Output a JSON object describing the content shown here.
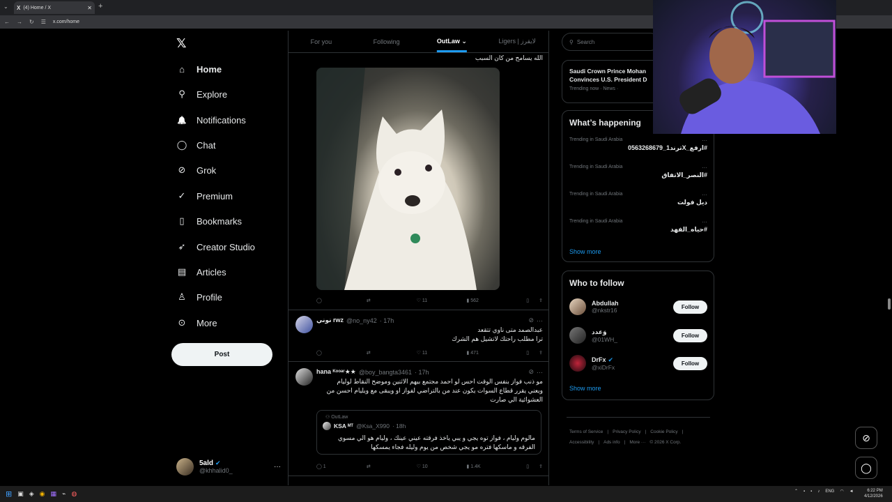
{
  "browser": {
    "tab_title": "(4) Home / X",
    "tab_close": "✕",
    "new_tab": "+",
    "url": "x.com/home"
  },
  "logo": "𝕏",
  "nav": {
    "items": [
      {
        "label": "Home",
        "icon": "home-icon",
        "glyph": "⌂"
      },
      {
        "label": "Explore",
        "icon": "search-icon",
        "glyph": "⚲"
      },
      {
        "label": "Notifications",
        "icon": "bell-icon",
        "glyph": "🔔"
      },
      {
        "label": "Chat",
        "icon": "chat-icon",
        "glyph": "◯"
      },
      {
        "label": "Grok",
        "icon": "grok-icon",
        "glyph": "⊘"
      },
      {
        "label": "Premium",
        "icon": "premium-icon",
        "glyph": "✓"
      },
      {
        "label": "Bookmarks",
        "icon": "bookmark-icon",
        "glyph": "▯"
      },
      {
        "label": "Creator Studio",
        "icon": "rocket-icon",
        "glyph": "➶"
      },
      {
        "label": "Articles",
        "icon": "articles-icon",
        "glyph": "▤"
      },
      {
        "label": "Profile",
        "icon": "person-icon",
        "glyph": "♙"
      },
      {
        "label": "More",
        "icon": "more-circle-icon",
        "glyph": "⊙"
      }
    ],
    "post_button": "Post",
    "account": {
      "name": "5ald",
      "handle": "@khhalid0_",
      "menu": "···"
    }
  },
  "timeline_tabs": [
    "For you",
    "Following",
    "OutLaw ⌄",
    "Ligers | لايقرز"
  ],
  "tweets": [
    {
      "text": "الله يسامح من كان السبب",
      "actions": {
        "reply": "",
        "retweet": "",
        "like": "11",
        "views": "562"
      }
    },
    {
      "name": "نوني rwz",
      "handle": "@no_ny42",
      "time": "· 17h",
      "lines": [
        "عبدالصمد متى ناوي تتقعد",
        "ترا مطلب راحتك لاتشيل هم الشرك"
      ],
      "actions": {
        "reply": "",
        "retweet": "",
        "like": "11",
        "views": "471"
      }
    },
    {
      "name": "hana ᴷᵒᵒᵃʳ★★",
      "handle": "@boy_bangta3461",
      "time": "· 17h",
      "lines": [
        "مو ذنب فواز بنفس الوقت احس لو احمد مجتمع بيهم الاثنين وموضح النقاط لوليام",
        "ويعني يقرر قطاع السوات يكون عند من  بالتراضي لفواز او ويبقى مع ويليام احسن من",
        "العشوائية الي صارت"
      ],
      "quote": {
        "community": "OutLaw",
        "name": "KSA ᴹᵀ",
        "handle": "@Ksa_X990",
        "time": "· 18h",
        "lines": [
          "مالوم وليام ، فواز توه يجي و يبي ياخذ فرقته عيني عينك ، وليام هو الي مسوي",
          "الفرقه و ماسكها فتره مو يجي شخص من يوم وليله فجاء يمسكها"
        ]
      },
      "actions": {
        "reply": "1",
        "retweet": "",
        "like": "10",
        "views": "1.4K"
      }
    }
  ],
  "right": {
    "search_placeholder": "Search",
    "news": {
      "headline1": "Saudi Crown Prince Mohan",
      "headline2": "Convinces U.S. President D",
      "meta": "Trending now · News ·"
    },
    "happening": {
      "title": "What’s happening",
      "trends": [
        {
          "context": "Trending in Saudi Arabia",
          "tag": "#ارفع_Xترند1_0563268679"
        },
        {
          "context": "Trending in Saudi Arabia",
          "tag": "#النصر_الاتفاق"
        },
        {
          "context": "Trending in Saudi Arabia",
          "tag": "ديل فولت"
        },
        {
          "context": "Trending in Saudi Arabia",
          "tag": "#حياه_الفهد"
        }
      ],
      "show_more": "Show more",
      "more": "···"
    },
    "who_to_follow": {
      "title": "Who to follow",
      "users": [
        {
          "name": "Abdullah",
          "handle": "@nkstr16"
        },
        {
          "name": "وَعدد",
          "handle": "@01WH_"
        },
        {
          "name": "DrFx",
          "handle": "@xiDrFx"
        }
      ],
      "follow_label": "Follow",
      "show_more": "Show more"
    },
    "footer": {
      "line1": [
        "Terms of Service",
        "|",
        "Privacy Policy",
        "|",
        "Cookie Policy",
        "|"
      ],
      "line2": [
        "Accessibility",
        "|",
        "Ads info",
        "|",
        "More ···",
        "© 2026 X Corp."
      ]
    }
  },
  "taskbar": {
    "lang": "ENG",
    "time": "6:22 PM",
    "date": "4/12/2026"
  },
  "colors": {
    "accent": "#1d9bf0",
    "background": "#000000",
    "border": "#2f3336",
    "muted": "#71767b"
  }
}
